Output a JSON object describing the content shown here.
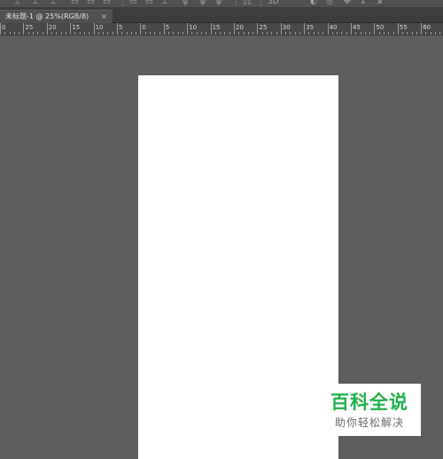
{
  "document_tab": {
    "title": "未标题-1 @ 25%(RGB/8)",
    "close_symbol": "×"
  },
  "ruler": {
    "labels": [
      "0",
      "25",
      "20",
      "15",
      "10",
      "5",
      "0",
      "5",
      "10",
      "15",
      "20",
      "25",
      "30",
      "35",
      "40",
      "45",
      "50",
      "55",
      "60"
    ]
  },
  "options_bar": {
    "icons": [
      "align-icon",
      "distribute-icon",
      "arrange-icon",
      "3d-mode-icon"
    ]
  },
  "watermark": {
    "main": "百科全说",
    "sub": "助你轻松解决",
    "main_color": "#20b24a",
    "sub_color": "#6b6b6b"
  },
  "colors": {
    "workspace": "#5e5e5e",
    "canvas": "#ffffff",
    "tab_bar": "#3d3d3d",
    "active_tab": "#505050",
    "ruler": "#484848"
  }
}
